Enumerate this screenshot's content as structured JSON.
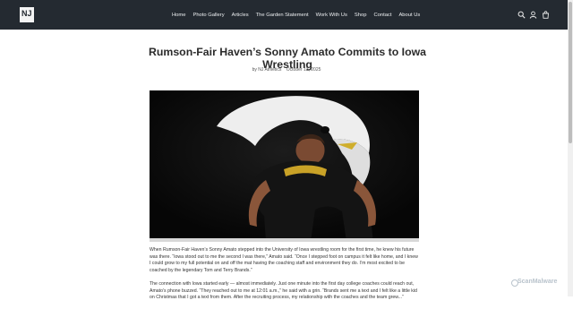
{
  "site": {
    "logo_text": "NJ",
    "nav": [
      "Home",
      "Photo Gallery",
      "Articles",
      "The Garden Statement",
      "Work With Us",
      "Shop",
      "Contact",
      "About Us"
    ],
    "icons": [
      "search-icon",
      "account-icon",
      "cart-icon"
    ]
  },
  "article": {
    "title": "Rumson-Fair Haven’s Sonny Amato Commits to Iowa Wrestling",
    "author": "by NJ Athletics",
    "date": "October 12, 2025",
    "paragraphs": [
      "When Rumson-Fair Haven’s Sonny Amato stepped into the University of Iowa wrestling room for the first time, he knew his future was there. “Iowa stood out to me the second I was there,” Amato said. “Once I stepped foot on campus it felt like home, and I knew I could grow to my full potential on and off the mat having the coaching staff and environment they do. I’m most excited to be coached by the legendary Tom and Terry Brands.”",
      "The connection with Iowa started early — almost immediately. Just one minute into the first day college coaches could reach out, Amato’s phone buzzed. “They reached out to me at 12:01 a.m.,” he said with a grin. “Brands sent me a text and I felt like a little kid on Christmas that I got a text from them. After the recruiting process, my relationship with the coaches and the team grew...”"
    ]
  },
  "watermark": "ScanMalware",
  "colors": {
    "header_bg": "#242a31",
    "hero_bg": "#0b0b0b"
  }
}
